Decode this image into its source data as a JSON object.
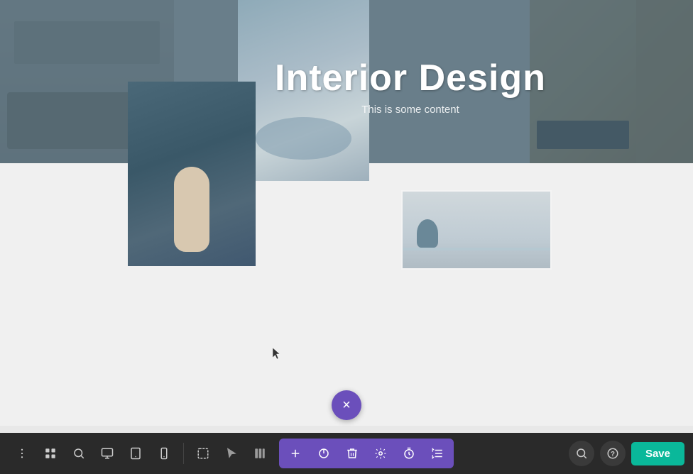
{
  "canvas": {
    "background": "#f0f0f0"
  },
  "hero": {
    "title": "Interior Design",
    "subtitle": "This is some content",
    "overlay_color": "rgba(75, 100, 115, 0.82)"
  },
  "floating_button": {
    "icon": "×",
    "color": "#6b4fbb"
  },
  "toolbar": {
    "left_group": [
      {
        "name": "menu-icon",
        "symbol": "⋮"
      },
      {
        "name": "grid-icon",
        "symbol": "⊞"
      },
      {
        "name": "search-icon",
        "symbol": "🔍"
      },
      {
        "name": "monitor-icon",
        "symbol": "🖥"
      },
      {
        "name": "tablet-icon",
        "symbol": "▭"
      },
      {
        "name": "mobile-icon",
        "symbol": "📱"
      }
    ],
    "middle_group": [
      {
        "name": "select-icon",
        "symbol": "⬚"
      },
      {
        "name": "pointer-icon",
        "symbol": "✦"
      },
      {
        "name": "layout-icon",
        "symbol": "⊟"
      }
    ],
    "purple_group": [
      {
        "name": "add-icon",
        "symbol": "+"
      },
      {
        "name": "power-icon",
        "symbol": "⏻"
      },
      {
        "name": "delete-icon",
        "symbol": "🗑"
      },
      {
        "name": "settings-icon",
        "symbol": "⚙"
      },
      {
        "name": "timer-icon",
        "symbol": "⏱"
      },
      {
        "name": "sort-icon",
        "symbol": "⇅"
      }
    ],
    "right_group": [
      {
        "name": "search-circle-icon",
        "symbol": "🔍"
      },
      {
        "name": "help-icon",
        "symbol": "?"
      }
    ],
    "save_label": "Save",
    "save_color": "#0ab89a"
  }
}
